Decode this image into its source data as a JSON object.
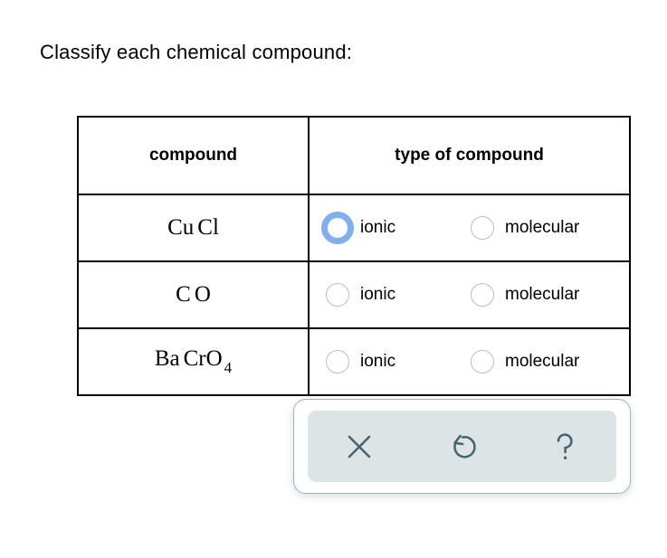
{
  "prompt": "Classify each chemical compound:",
  "table": {
    "headers": {
      "compound": "compound",
      "type": "type of compound"
    },
    "rows": [
      {
        "formula_text": "CuCl",
        "formula_parts": [
          {
            "text": "Cu"
          },
          {
            "text": "Cl"
          }
        ],
        "subscript": "",
        "options": [
          {
            "label": "ionic",
            "selected": true
          },
          {
            "label": "molecular",
            "selected": false
          }
        ]
      },
      {
        "formula_text": "CO",
        "formula_parts": [
          {
            "text": "C"
          },
          {
            "text": "O"
          }
        ],
        "subscript": "",
        "options": [
          {
            "label": "ionic",
            "selected": false
          },
          {
            "label": "molecular",
            "selected": false
          }
        ]
      },
      {
        "formula_text": "BaCrO4",
        "formula_parts": [
          {
            "text": "Ba"
          },
          {
            "text": "CrO"
          }
        ],
        "subscript": "4",
        "options": [
          {
            "label": "ionic",
            "selected": false
          },
          {
            "label": "molecular",
            "selected": false
          }
        ]
      }
    ]
  },
  "toolbar": {
    "buttons": [
      {
        "name": "close",
        "icon": "x-icon",
        "label": "×"
      },
      {
        "name": "reset",
        "icon": "undo-arrow-icon",
        "label": "↺"
      },
      {
        "name": "help",
        "icon": "question-mark-icon",
        "label": "?"
      }
    ]
  },
  "colors": {
    "selected_radio_ring": "#7fafee",
    "unselected_radio_border": "#bdbdbd",
    "toolbar_inner_bg": "#dde4e6",
    "toolbar_border": "#9db4bc",
    "icon_color": "#426570",
    "table_border": "#000000"
  }
}
